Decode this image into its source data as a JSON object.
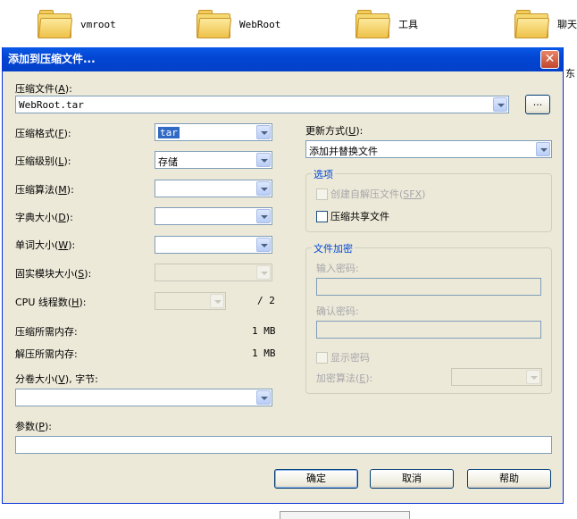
{
  "desktop": {
    "items": [
      {
        "label": "vmroot"
      },
      {
        "label": "WebRoot"
      },
      {
        "label": "工具"
      },
      {
        "label": "聊天"
      }
    ],
    "side_text": "东"
  },
  "dialog": {
    "title": "添加到压缩文件...",
    "archive": {
      "label": "压缩文件",
      "key": "A",
      "value": "WebRoot.tar",
      "browse_label": "..."
    },
    "format": {
      "label": "压缩格式",
      "key": "F",
      "value": "tar"
    },
    "level": {
      "label": "压缩级别",
      "key": "L",
      "value": "存储"
    },
    "method": {
      "label": "压缩算法",
      "key": "M",
      "value": ""
    },
    "dict_size": {
      "label": "字典大小",
      "key": "D",
      "value": ""
    },
    "word_size": {
      "label": "单词大小",
      "key": "W",
      "value": ""
    },
    "solid_block": {
      "label": "固实模块大小",
      "key": "S",
      "value": ""
    },
    "cpu_threads": {
      "label": "CPU 线程数",
      "key": "H",
      "value": "",
      "total": "/ 2"
    },
    "mem_compress": {
      "label": "压缩所需内存:",
      "value": "1 MB"
    },
    "mem_decompress": {
      "label": "解压所需内存:",
      "value": "1 MB"
    },
    "volume": {
      "label": "分卷大小",
      "key": "V",
      "suffix": ", 字节:",
      "value": ""
    },
    "params": {
      "label": "参数",
      "key": "P",
      "value": ""
    },
    "update_mode": {
      "label": "更新方式",
      "key": "U",
      "value": "添加并替换文件"
    },
    "options": {
      "title": "选项",
      "sfx": {
        "label": "创建自解压文件",
        "key": "SFX"
      },
      "shared": {
        "label": "压缩共享文件"
      }
    },
    "encryption": {
      "title": "文件加密",
      "enter_password": "输入密码:",
      "confirm_password": "确认密码:",
      "show_password": "显示密码",
      "method": {
        "label": "加密算法",
        "key": "E"
      }
    },
    "buttons": {
      "ok": "确定",
      "cancel": "取消",
      "help": "帮助"
    }
  }
}
